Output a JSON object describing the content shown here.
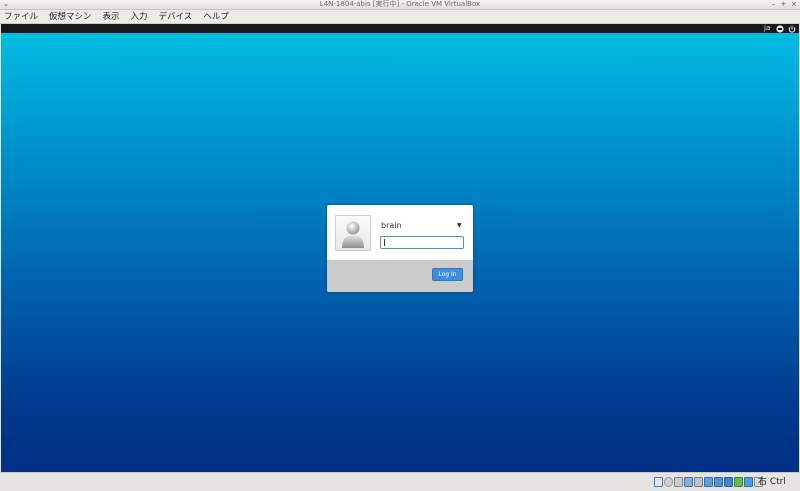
{
  "window": {
    "title": "L4N-1804-abis [実行中] - Oracle VM VirtualBox",
    "sys_menu_icon": "⌄",
    "minimize_glyph": "–",
    "maximize_glyph": "+",
    "close_glyph": "×"
  },
  "menubar": {
    "items": [
      "ファイル",
      "仮想マシン",
      "表示",
      "入力",
      "デバイス",
      "ヘルプ"
    ]
  },
  "guest_topbar": {
    "language": "ja",
    "network_icon": "network-icon",
    "power_icon": "power-icon"
  },
  "login": {
    "username": "brain",
    "password_value": "",
    "button_label": "Log In",
    "dropdown_glyph": "▼"
  },
  "statusbar": {
    "host_key": "右 Ctrl",
    "icons": [
      "hard-disk-icon",
      "optical-drive-icon",
      "audio-icon",
      "network-icon",
      "usb-icon",
      "shared-folders-icon",
      "display-icon",
      "recording-icon",
      "cpu-icon",
      "mouse-integration-icon",
      "keyboard-icon"
    ]
  },
  "colors": {
    "desktop_top": "#00c0e4",
    "desktop_bottom": "#002f86",
    "login_button": "#3d8ee0",
    "input_focus": "#4a90d9"
  }
}
